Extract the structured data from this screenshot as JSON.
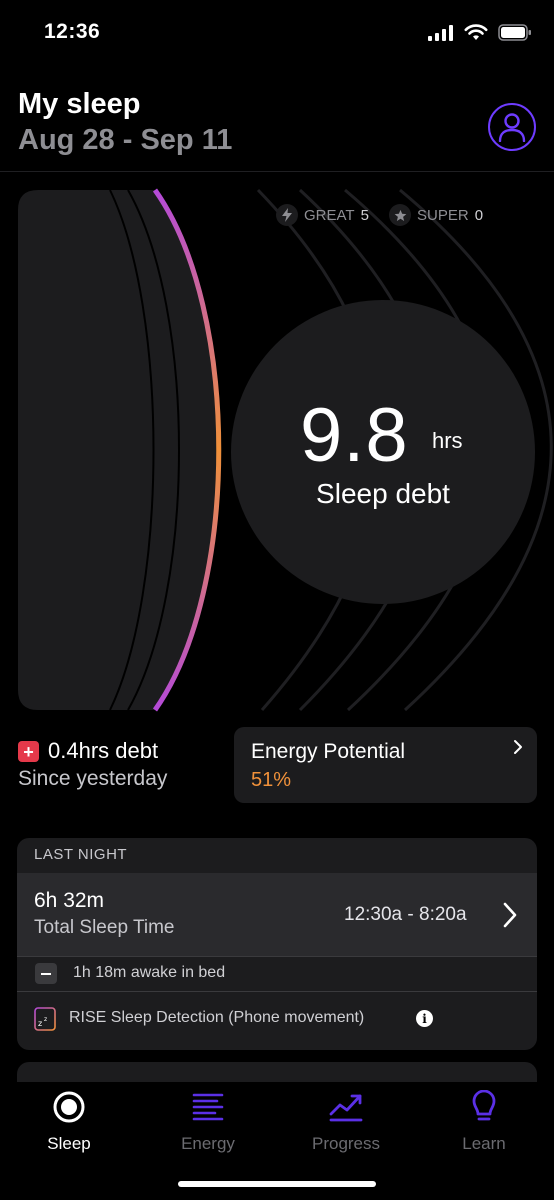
{
  "status_bar": {
    "time": "12:36"
  },
  "header": {
    "title": "My sleep",
    "subtitle": "Aug 28 - Sep 11",
    "profile_icon": "user-icon"
  },
  "hero": {
    "badges": [
      {
        "icon": "lightning-icon",
        "label": "GREAT",
        "count": "5"
      },
      {
        "icon": "star-icon",
        "label": "SUPER",
        "count": "0"
      }
    ],
    "debt_value": "9.8",
    "debt_unit": "hrs",
    "debt_label": "Sleep debt",
    "arc_gradient": [
      "#b44ad8",
      "#f0913a"
    ]
  },
  "summary": {
    "debt_change": "0.4hrs debt",
    "debt_change_label": "Since yesterday",
    "energy_title": "Energy Potential",
    "energy_value": "51%"
  },
  "last_night": {
    "header": "LAST NIGHT",
    "duration": "6h 32m",
    "duration_label": "Total Sleep Time",
    "range": "12:30a - 8:20a",
    "awake": "1h 18m awake in bed",
    "detection": "RISE Sleep Detection (Phone movement)"
  },
  "tabs": [
    {
      "label": "Sleep",
      "icon": "sleep-icon",
      "active": true
    },
    {
      "label": "Energy",
      "icon": "energy-icon",
      "active": false
    },
    {
      "label": "Progress",
      "icon": "progress-icon",
      "active": false
    },
    {
      "label": "Learn",
      "icon": "lightbulb-icon",
      "active": false
    }
  ],
  "colors": {
    "accent": "#6e3cff",
    "orange": "#f0913a",
    "red": "#e5394a",
    "card": "#1c1c1e"
  }
}
